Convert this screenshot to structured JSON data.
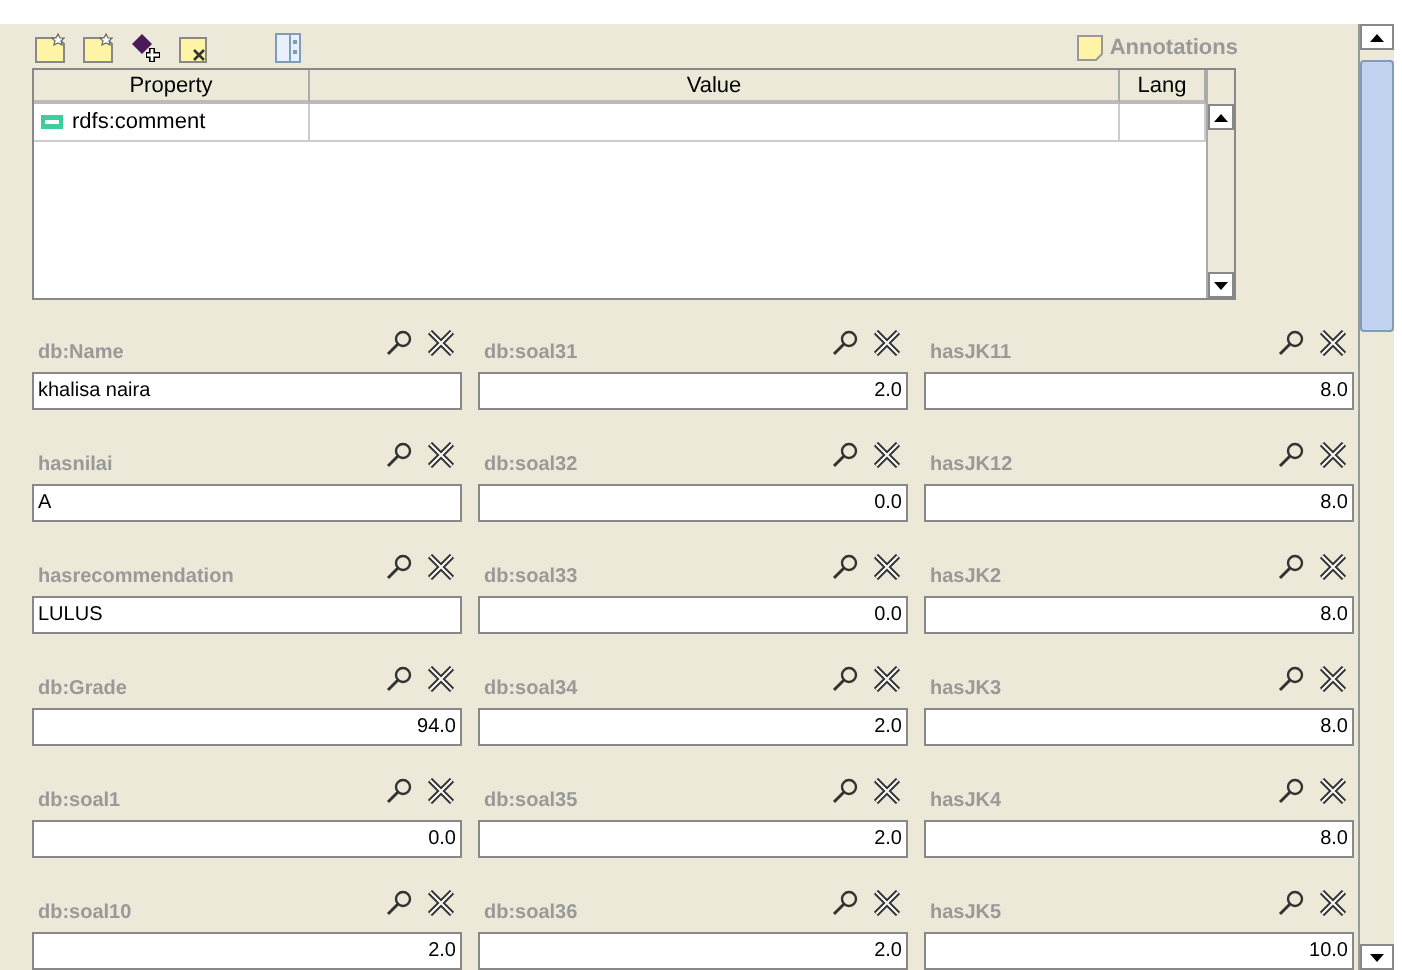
{
  "toolbar": {
    "annotations_label": "Annotations"
  },
  "annotations_table": {
    "columns": [
      "Property",
      "Value",
      "Lang"
    ],
    "rows": [
      {
        "property": "rdfs:comment",
        "value": "",
        "lang": ""
      }
    ]
  },
  "fields": [
    {
      "label": "db:Name",
      "value": "khalisa naira",
      "kind": "text"
    },
    {
      "label": "db:soal31",
      "value": "2.0",
      "kind": "number"
    },
    {
      "label": "hasJK11",
      "value": "8.0",
      "kind": "number"
    },
    {
      "label": "hasnilai",
      "value": "A",
      "kind": "text"
    },
    {
      "label": "db:soal32",
      "value": "0.0",
      "kind": "number"
    },
    {
      "label": "hasJK12",
      "value": "8.0",
      "kind": "number"
    },
    {
      "label": "hasrecommendation",
      "value": "LULUS",
      "kind": "text"
    },
    {
      "label": "db:soal33",
      "value": "0.0",
      "kind": "number"
    },
    {
      "label": "hasJK2",
      "value": "8.0",
      "kind": "number"
    },
    {
      "label": "db:Grade",
      "value": "94.0",
      "kind": "number"
    },
    {
      "label": "db:soal34",
      "value": "2.0",
      "kind": "number"
    },
    {
      "label": "hasJK3",
      "value": "8.0",
      "kind": "number"
    },
    {
      "label": "db:soal1",
      "value": "0.0",
      "kind": "number"
    },
    {
      "label": "db:soal35",
      "value": "2.0",
      "kind": "number"
    },
    {
      "label": "hasJK4",
      "value": "8.0",
      "kind": "number"
    },
    {
      "label": "db:soal10",
      "value": "2.0",
      "kind": "number"
    },
    {
      "label": "db:soal36",
      "value": "2.0",
      "kind": "number"
    },
    {
      "label": "hasJK5",
      "value": "10.0",
      "kind": "number"
    }
  ]
}
